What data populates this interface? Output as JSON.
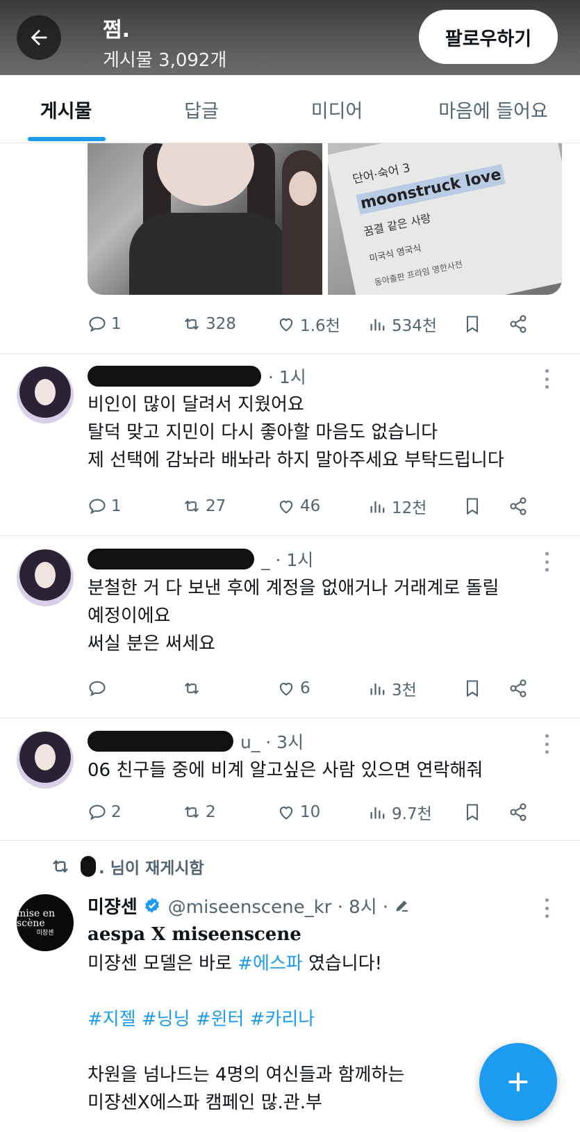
{
  "header": {
    "title": "쩜.",
    "post_count": "게시물 3,092개",
    "follow_label": "팔로우하기"
  },
  "tabs": [
    {
      "label": "게시물",
      "active": true
    },
    {
      "label": "답글",
      "active": false
    },
    {
      "label": "미디어",
      "active": false
    },
    {
      "label": "마음에 들어요",
      "active": false
    }
  ],
  "media_post": {
    "dict_image": {
      "heading": "단어·숙어 3",
      "word": "moonstruck love",
      "meaning": "꿈결 같은 사랑",
      "pron": "미국식  영국식",
      "source": "동아출판 프라임 영한사전"
    },
    "stats": {
      "replies": "1",
      "reposts": "328",
      "likes": "1.6천",
      "views": "534천"
    }
  },
  "tweets": [
    {
      "handle_tail": "· 1시",
      "lines": [
        "비인이 많이 달려서 지웠어요",
        "탈덕 맞고 지민이 다시 좋아할 마음도 없습니다",
        "제 선택에 감놔라 배놔라 하지 말아주세요 부탁드립니다"
      ],
      "stats": {
        "replies": "1",
        "reposts": "27",
        "likes": "46",
        "views": "12천"
      }
    },
    {
      "handle_tail": "_ · 1시",
      "lines": [
        "분철한 거 다 보낸 후에 계정을 없애거나 거래계로 돌릴",
        "예정이에요",
        "써실 분은 써세요"
      ],
      "stats": {
        "replies": "",
        "reposts": "",
        "likes": "6",
        "views": "3천"
      }
    },
    {
      "handle_tail": "u_ · 3시",
      "lines": [
        "06 친구들 중에 비계 알고싶은 사람 있으면 연락해줘"
      ],
      "stats": {
        "replies": "2",
        "reposts": "2",
        "likes": "10",
        "views": "9.7천"
      }
    }
  ],
  "repost": {
    "label": ". 님이 재게시함",
    "brand_avatar_l1": "mise en scène",
    "brand_avatar_l2": "미장센",
    "name": "미쟝센",
    "handle": "@miseenscene_kr · 8시 ·",
    "headline": "aespa X miseenscene",
    "line1_pre": "미쟝센 모델은 바로 ",
    "line1_tag": "#에스파",
    "line1_post": " 였습니다!",
    "tags": "#지젤 #닝닝 #윈터 #카리나",
    "line3": "차원을 넘나드는 4명의 여신들과 함께하는",
    "line4": "미쟝센X에스파 캠페인 많.관.부"
  },
  "colors": {
    "accent": "#1d9bf0",
    "muted": "#536471",
    "text": "#0f1419"
  }
}
